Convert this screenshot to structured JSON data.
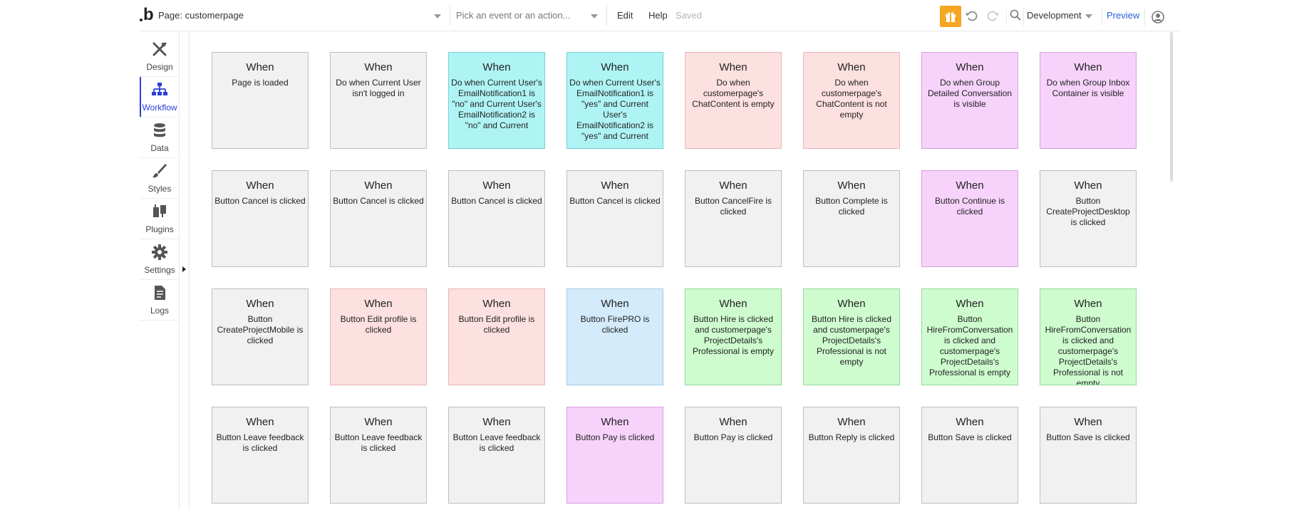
{
  "topbar": {
    "logo": "b",
    "page_label": "Page: customerpage",
    "event_placeholder": "Pick an event or an action...",
    "edit": "Edit",
    "help": "Help",
    "saved": "Saved",
    "environment": "Development",
    "preview": "Preview",
    "colors": {
      "gift_bg": "#f5a623",
      "preview_link": "#2b5fd9"
    }
  },
  "sidebar": {
    "items": [
      {
        "label": "Design",
        "icon": "design-icon"
      },
      {
        "label": "Workflow",
        "icon": "workflow-icon",
        "active": true
      },
      {
        "label": "Data",
        "icon": "database-icon"
      },
      {
        "label": "Styles",
        "icon": "brush-icon"
      },
      {
        "label": "Plugins",
        "icon": "plug-icon"
      },
      {
        "label": "Settings",
        "icon": "gear-icon"
      },
      {
        "label": "Logs",
        "icon": "document-icon"
      }
    ],
    "active_color": "#2b3fd6"
  },
  "workflows": {
    "when": "When",
    "colors": {
      "gray": "#f0f1f0",
      "cyan": "#aff4f5",
      "pink": "#fde0e0",
      "violet": "#f7d3fb",
      "blue": "#d3ebfb",
      "green": "#cefccf"
    },
    "rows": [
      [
        {
          "text": "Page is loaded",
          "color": "gray"
        },
        {
          "text": "Do when Current User isn't logged in",
          "color": "gray"
        },
        {
          "text": "Do when Current User's EmailNotification1 is \"no\" and Current User's EmailNotification2 is \"no\" and Current",
          "color": "cyan"
        },
        {
          "text": "Do when Current User's EmailNotification1 is \"yes\" and Current User's EmailNotification2 is \"yes\" and Current",
          "color": "cyan"
        },
        {
          "text": "Do when customerpage's ChatContent is empty",
          "color": "pink"
        },
        {
          "text": "Do when customerpage's ChatContent is not empty",
          "color": "pink"
        },
        {
          "text": "Do when Group Detailed Conversation is visible",
          "color": "violet"
        },
        {
          "text": "Do when Group Inbox Container is visible",
          "color": "violet"
        }
      ],
      [
        {
          "text": "Button Cancel is clicked",
          "color": "gray"
        },
        {
          "text": "Button Cancel is clicked",
          "color": "gray"
        },
        {
          "text": "Button Cancel is clicked",
          "color": "gray"
        },
        {
          "text": "Button Cancel is clicked",
          "color": "gray"
        },
        {
          "text": "Button CancelFire is clicked",
          "color": "gray"
        },
        {
          "text": "Button Complete is clicked",
          "color": "gray"
        },
        {
          "text": "Button Continue is clicked",
          "color": "violet"
        },
        {
          "text": "Button CreateProjectDesktop is clicked",
          "color": "gray"
        }
      ],
      [
        {
          "text": "Button CreateProjectMobile is clicked",
          "color": "gray"
        },
        {
          "text": "Button Edit profile is clicked",
          "color": "pink"
        },
        {
          "text": "Button Edit profile is clicked",
          "color": "pink"
        },
        {
          "text": "Button FirePRO is clicked",
          "color": "blue"
        },
        {
          "text": "Button Hire is clicked and customerpage's ProjectDetails's Professional is empty",
          "color": "green"
        },
        {
          "text": "Button Hire is clicked and customerpage's ProjectDetails's Professional is not empty",
          "color": "green"
        },
        {
          "text": "Button HireFromConversation is clicked and customerpage's ProjectDetails's Professional is empty",
          "color": "green"
        },
        {
          "text": "Button HireFromConversation is clicked and customerpage's ProjectDetails's Professional is not empty",
          "color": "green"
        }
      ],
      [
        {
          "text": "Button Leave feedback is clicked",
          "color": "gray"
        },
        {
          "text": "Button Leave feedback is clicked",
          "color": "gray"
        },
        {
          "text": "Button Leave feedback is clicked",
          "color": "gray"
        },
        {
          "text": "Button Pay is clicked",
          "color": "violet"
        },
        {
          "text": "Button Pay is clicked",
          "color": "gray"
        },
        {
          "text": "Button Reply is clicked",
          "color": "gray"
        },
        {
          "text": "Button Save is clicked",
          "color": "gray"
        },
        {
          "text": "Button Save is clicked",
          "color": "gray"
        }
      ]
    ]
  }
}
